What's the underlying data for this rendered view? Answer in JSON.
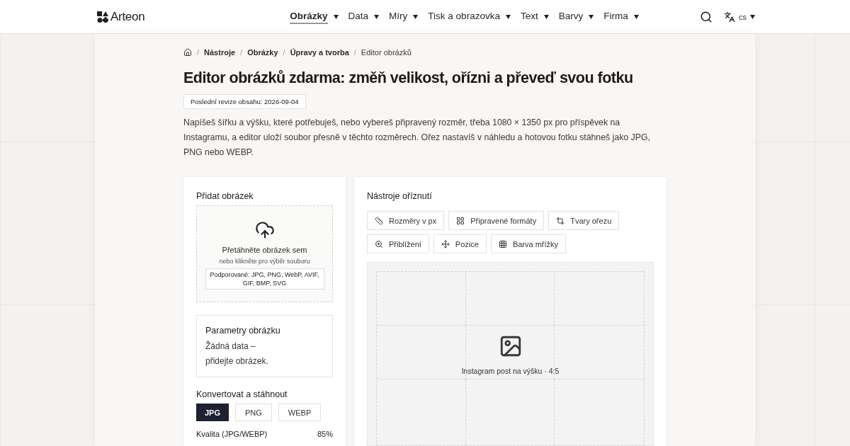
{
  "header": {
    "logo": "Arteon",
    "nav": [
      {
        "label": "Obrázky",
        "selected": true
      },
      {
        "label": "Data",
        "selected": false
      },
      {
        "label": "Míry",
        "selected": false
      },
      {
        "label": "Tisk a obrazovka",
        "selected": false
      },
      {
        "label": "Text",
        "selected": false
      },
      {
        "label": "Barvy",
        "selected": false
      },
      {
        "label": "Firma",
        "selected": false
      }
    ],
    "language": "cs"
  },
  "breadcrumb": {
    "separator": "/",
    "items": [
      "Nástroje",
      "Obrázky",
      "Úpravy a tvorba"
    ],
    "current": "Editor obrázků"
  },
  "title": "Editor obrázků zdarma: změň velikost, ořízni a převeď svou fotku",
  "revision": "Poslední revize obsahu: 2026-09-04",
  "intro": "Napíšeš šířku a výšku, které potřebuješ, nebo vybereš připravený rozměr, třeba 1080 × 1350 px pro příspěvek na Instagramu, a editor uloží soubor přesně v těchto rozměrech. Ořez nastavíš v náhledu a hotovou fotku stáhneš jako JPG, PNG nebo WEBP.",
  "upload": {
    "title": "Přidat obrázek",
    "drop_title": "Přetáhněte obrázek sem",
    "drop_hint": "nebo klikněte pro výběr souboru",
    "formats": "Podporované: JPG, PNG, WebP, AVIF, GIF, BMP, SVG"
  },
  "params": {
    "title": "Parametry obrázku",
    "text": "Žádná data – přidejte obrázek."
  },
  "convert": {
    "title": "Konvertovat a stáhnout",
    "formats": [
      {
        "label": "JPG",
        "selected": true
      },
      {
        "label": "PNG",
        "selected": false
      },
      {
        "label": "WEBP",
        "selected": false
      }
    ],
    "quality_label": "Kvalita (JPG/WEBP)",
    "quality_value": "85%"
  },
  "tools": {
    "title": "Nástroje oříznutí",
    "buttons": [
      {
        "label": "Rozměry v px",
        "kind": "ruler"
      },
      {
        "label": "Připravené formáty",
        "kind": "layout"
      },
      {
        "label": "Tvary ořezu",
        "kind": "crop"
      },
      {
        "label": "Přiblížení",
        "kind": "zoom"
      },
      {
        "label": "Pozice",
        "kind": "move"
      },
      {
        "label": "Barva mřížky",
        "kind": "grid"
      }
    ],
    "preview_caption": "Instagram post na výšku · 4:5"
  }
}
